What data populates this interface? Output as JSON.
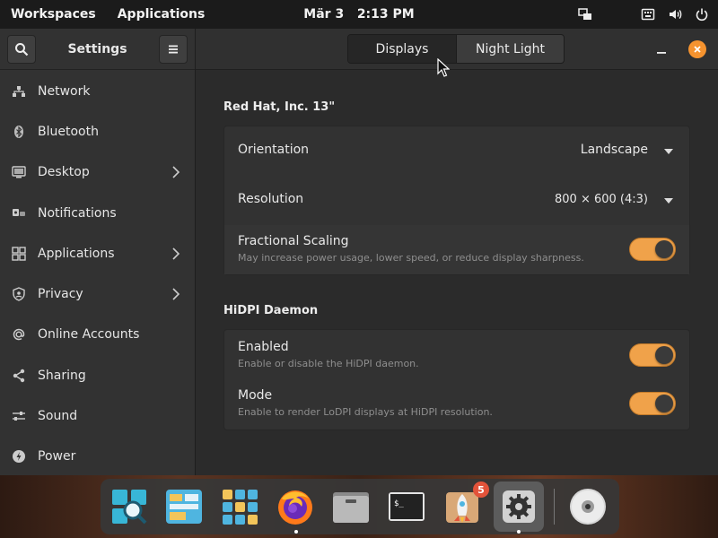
{
  "panel": {
    "workspaces": "Workspaces",
    "applications": "Applications",
    "date": "Mär 3",
    "time": "2:13 PM"
  },
  "sidebar": {
    "title": "Settings",
    "items": [
      {
        "label": "Network",
        "icon": "network-icon",
        "chevron": false
      },
      {
        "label": "Bluetooth",
        "icon": "bluetooth-icon",
        "chevron": false
      },
      {
        "label": "Desktop",
        "icon": "desktop-icon",
        "chevron": true
      },
      {
        "label": "Notifications",
        "icon": "notifications-icon",
        "chevron": false
      },
      {
        "label": "Applications",
        "icon": "applications-icon",
        "chevron": true
      },
      {
        "label": "Privacy",
        "icon": "privacy-icon",
        "chevron": true
      },
      {
        "label": "Online Accounts",
        "icon": "at-icon",
        "chevron": false
      },
      {
        "label": "Sharing",
        "icon": "sharing-icon",
        "chevron": false
      },
      {
        "label": "Sound",
        "icon": "sound-icon",
        "chevron": false
      },
      {
        "label": "Power",
        "icon": "power-icon",
        "chevron": false
      }
    ]
  },
  "tabs": {
    "displays": "Displays",
    "night_light": "Night Light",
    "active": "Displays"
  },
  "display": {
    "name": "Red Hat, Inc. 13\"",
    "orientation_label": "Orientation",
    "orientation_value": "Landscape",
    "resolution_label": "Resolution",
    "resolution_value": "800 × 600 (4:3)",
    "scaling_label": "Fractional Scaling",
    "scaling_desc": "May increase power usage, lower speed, or reduce display sharpness.",
    "scaling_on": true
  },
  "hidpi": {
    "title": "HiDPI Daemon",
    "enabled_label": "Enabled",
    "enabled_desc": "Enable or disable the HiDPI daemon.",
    "enabled_on": true,
    "mode_label": "Mode",
    "mode_desc": "Enable to render LoDPI displays at HiDPI resolution.",
    "mode_on": true
  },
  "dock": {
    "updates_badge": "5",
    "apps": [
      "search-app",
      "files-app",
      "app-grid",
      "firefox",
      "file-manager",
      "terminal",
      "updates-app",
      "settings",
      "disc-app"
    ]
  },
  "colors": {
    "accent": "#f0a24a",
    "close": "#f5932f"
  }
}
